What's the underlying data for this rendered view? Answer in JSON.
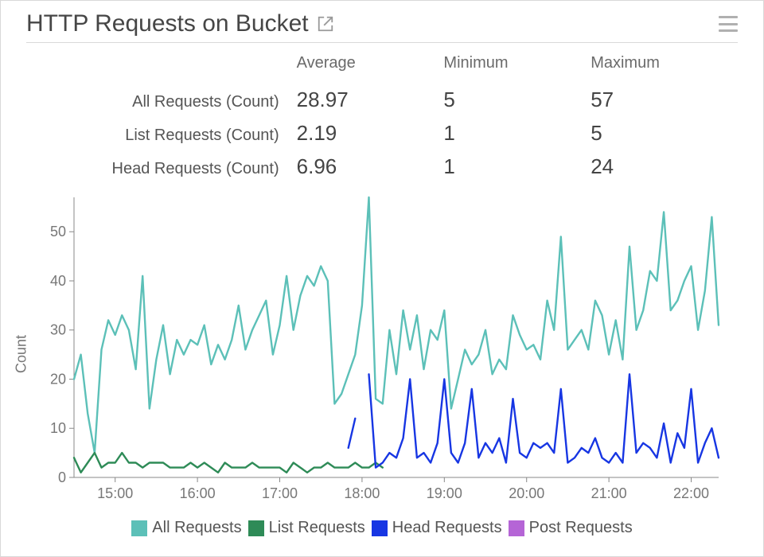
{
  "header": {
    "title": "HTTP Requests on Bucket"
  },
  "stats": {
    "columns": [
      "Average",
      "Minimum",
      "Maximum"
    ],
    "rows": [
      {
        "label": "All Requests (Count)",
        "avg": "28.97",
        "min": "5",
        "max": "57"
      },
      {
        "label": "List Requests (Count)",
        "avg": "2.19",
        "min": "1",
        "max": "5"
      },
      {
        "label": "Head Requests (Count)",
        "avg": "6.96",
        "min": "1",
        "max": "24"
      }
    ]
  },
  "legend": [
    {
      "name": "All Requests",
      "color": "#5cc0b8"
    },
    {
      "name": "List Requests",
      "color": "#2e8b57"
    },
    {
      "name": "Head Requests",
      "color": "#1736e3"
    },
    {
      "name": "Post Requests",
      "color": "#b565d6"
    }
  ],
  "chart_data": {
    "type": "line",
    "title": "HTTP Requests on Bucket",
    "xlabel": "",
    "ylabel": "Count",
    "ylim": [
      0,
      57
    ],
    "yticks": [
      0,
      10,
      20,
      30,
      40,
      50
    ],
    "x": [
      "14:30",
      "14:35",
      "14:40",
      "14:45",
      "14:50",
      "14:55",
      "15:00",
      "15:05",
      "15:10",
      "15:15",
      "15:20",
      "15:25",
      "15:30",
      "15:35",
      "15:40",
      "15:45",
      "15:50",
      "15:55",
      "16:00",
      "16:05",
      "16:10",
      "16:15",
      "16:20",
      "16:25",
      "16:30",
      "16:35",
      "16:40",
      "16:45",
      "16:50",
      "16:55",
      "17:00",
      "17:05",
      "17:10",
      "17:15",
      "17:20",
      "17:25",
      "17:30",
      "17:35",
      "17:40",
      "17:45",
      "17:50",
      "17:55",
      "18:00",
      "18:05",
      "18:10",
      "18:15",
      "18:20",
      "18:25",
      "18:30",
      "18:35",
      "18:40",
      "18:45",
      "18:50",
      "18:55",
      "19:00",
      "19:05",
      "19:10",
      "19:15",
      "19:20",
      "19:25",
      "19:30",
      "19:35",
      "19:40",
      "19:45",
      "19:50",
      "19:55",
      "20:00",
      "20:05",
      "20:10",
      "20:15",
      "20:20",
      "20:25",
      "20:30",
      "20:35",
      "20:40",
      "20:45",
      "20:50",
      "20:55",
      "21:00",
      "21:05",
      "21:10",
      "21:15",
      "21:20",
      "21:25",
      "21:30",
      "21:35",
      "21:40",
      "21:45",
      "21:50",
      "21:55",
      "22:00",
      "22:05",
      "22:10",
      "22:15",
      "22:20"
    ],
    "xticks": [
      "15:00",
      "16:00",
      "17:00",
      "18:00",
      "19:00",
      "20:00",
      "21:00",
      "22:00"
    ],
    "series": [
      {
        "name": "All Requests",
        "color": "#5cc0b8",
        "values": [
          20,
          25,
          13,
          5,
          26,
          32,
          29,
          33,
          30,
          22,
          41,
          14,
          24,
          31,
          21,
          28,
          25,
          28,
          27,
          31,
          23,
          27,
          24,
          28,
          35,
          26,
          30,
          33,
          36,
          25,
          31,
          41,
          30,
          37,
          41,
          39,
          43,
          40,
          15,
          17,
          21,
          25,
          35,
          57,
          16,
          15,
          30,
          21,
          34,
          26,
          33,
          22,
          30,
          28,
          34,
          14,
          20,
          26,
          23,
          25,
          30,
          21,
          24,
          22,
          33,
          29,
          26,
          27,
          24,
          36,
          30,
          49,
          26,
          28,
          30,
          26,
          36,
          33,
          25,
          32,
          24,
          47,
          30,
          34,
          42,
          40,
          54,
          34,
          36,
          40,
          43,
          30,
          38,
          53,
          31
        ]
      },
      {
        "name": "List Requests",
        "color": "#2e8b57",
        "values": [
          4,
          1,
          3,
          5,
          2,
          3,
          3,
          5,
          3,
          3,
          2,
          3,
          3,
          3,
          2,
          2,
          2,
          3,
          2,
          3,
          2,
          1,
          3,
          2,
          2,
          2,
          3,
          2,
          2,
          2,
          2,
          1,
          3,
          2,
          1,
          2,
          2,
          3,
          2,
          2,
          2,
          3,
          2,
          2,
          3,
          2,
          null,
          null,
          null,
          null,
          null,
          null,
          null,
          null,
          null,
          null,
          null,
          null,
          null,
          null,
          null,
          null,
          null,
          null,
          null,
          null,
          null,
          null,
          null,
          null,
          null,
          null,
          null,
          null,
          null,
          null,
          null,
          null,
          null,
          null,
          null,
          null,
          null,
          null,
          null,
          null,
          null,
          null,
          null,
          null,
          null,
          null,
          null,
          null,
          null
        ]
      },
      {
        "name": "Head Requests",
        "color": "#1736e3",
        "values": [
          null,
          null,
          null,
          null,
          null,
          null,
          null,
          null,
          null,
          null,
          null,
          null,
          null,
          null,
          null,
          null,
          null,
          null,
          null,
          null,
          null,
          null,
          null,
          null,
          null,
          2,
          null,
          null,
          null,
          null,
          null,
          null,
          null,
          null,
          null,
          null,
          null,
          null,
          2,
          null,
          6,
          12,
          null,
          21,
          2,
          3,
          5,
          4,
          8,
          20,
          4,
          5,
          3,
          7,
          20,
          5,
          3,
          7,
          18,
          4,
          7,
          5,
          8,
          3,
          16,
          5,
          4,
          7,
          6,
          7,
          5,
          18,
          3,
          4,
          6,
          5,
          8,
          4,
          3,
          5,
          3,
          21,
          5,
          7,
          6,
          4,
          11,
          3,
          9,
          6,
          18,
          3,
          7,
          10,
          4
        ]
      },
      {
        "name": "Post Requests",
        "color": "#b565d6",
        "values": [
          null,
          null,
          null,
          null,
          null,
          null,
          null,
          null,
          null,
          null,
          null,
          null,
          null,
          null,
          null,
          null,
          null,
          null,
          null,
          null,
          null,
          null,
          null,
          null,
          null,
          null,
          null,
          null,
          null,
          null,
          null,
          null,
          null,
          null,
          null,
          null,
          null,
          null,
          null,
          null,
          null,
          null,
          null,
          null,
          null,
          null,
          null,
          null,
          null,
          null,
          null,
          null,
          null,
          null,
          null,
          null,
          null,
          null,
          null,
          null,
          null,
          null,
          null,
          null,
          null,
          null,
          null,
          null,
          null,
          null,
          null,
          null,
          null,
          null,
          null,
          null,
          null,
          null,
          null,
          null,
          null,
          null,
          null,
          null,
          null,
          null,
          null,
          null,
          null,
          null,
          null,
          null,
          null,
          null,
          null
        ]
      }
    ]
  }
}
